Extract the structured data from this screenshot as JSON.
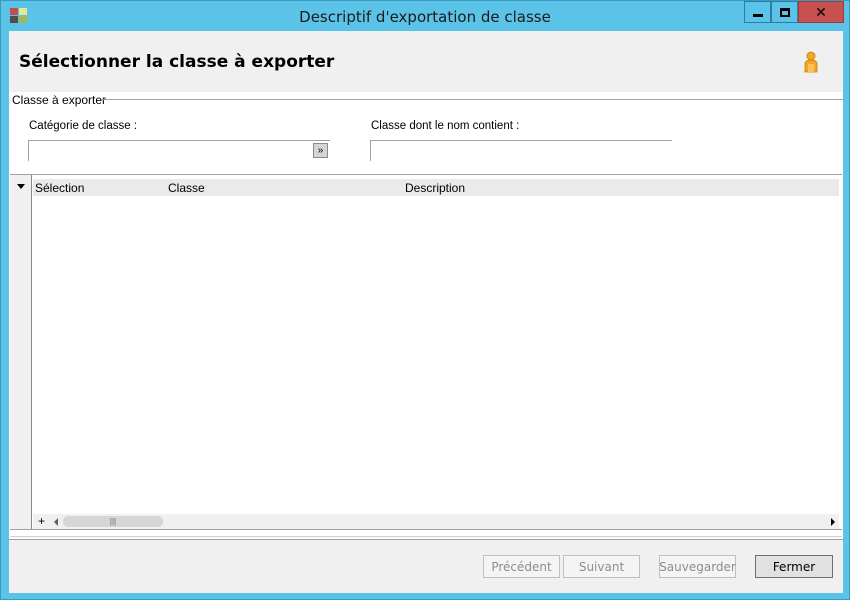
{
  "window": {
    "title": "Descriptif d'exportation de classe",
    "app_icon": "app-icon",
    "controls": {
      "minimize": "▁",
      "maximize": "□",
      "close": "✕"
    }
  },
  "header": {
    "title": "Sélectionner la classe à exporter",
    "icon": "user-icon"
  },
  "group": {
    "label": "Classe à exporter",
    "category_label": "Catégorie de classe :",
    "category_value": "",
    "name_filter_label": "Classe dont le nom contient :",
    "name_filter_value": ""
  },
  "grid": {
    "columns": [
      "Sélection",
      "Classe",
      "Description"
    ],
    "rows": []
  },
  "footer": {
    "buttons": {
      "previous": "Précédent",
      "next": "Suivant",
      "save": "Sauvegarder",
      "close": "Fermer"
    }
  },
  "colors": {
    "title_bar": "#5bc3e8",
    "close_button": "#c75050",
    "panel": "#f0f0f0"
  }
}
